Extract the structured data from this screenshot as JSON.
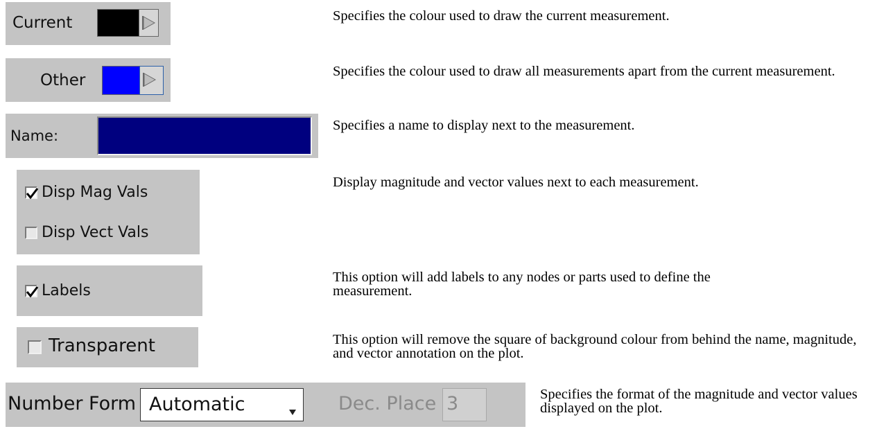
{
  "colours": {
    "current": "#000000",
    "other": "#0000ff",
    "name_field": "#00007f",
    "panel_bg": "#c4c4c4"
  },
  "rows": {
    "current": {
      "label": "Current",
      "swatch_color": "#000000",
      "arrow_icon": "triangle-right-icon",
      "description": "Specifies the colour used to draw the current measurement."
    },
    "other": {
      "label": "Other",
      "swatch_color": "#0000ff",
      "arrow_icon": "triangle-right-icon",
      "description": "Specifies the colour used to draw all measurements apart from the current measurement."
    },
    "name": {
      "label": "Name:",
      "value": "",
      "description": "Specifies a name to display next to the measurement."
    },
    "disp": {
      "mag_label": "Disp Mag Vals",
      "mag_checked": true,
      "vect_label": "Disp Vect Vals",
      "vect_checked": false,
      "description": "Display magnitude and vector values next to each measurement."
    },
    "labels": {
      "label": "Labels",
      "checked": true,
      "description": "This option will add labels to any nodes or parts used to define the measurement."
    },
    "transparent": {
      "label": "Transparent",
      "checked": false,
      "description": "This option will remove the square of background colour from behind the name, magnitude, and vector annotation on the plot."
    },
    "number_form": {
      "label": "Number Form",
      "selected": "Automatic",
      "dropdown_icon": "dropdown-arrow-icon",
      "dec_place_label": "Dec. Place",
      "dec_place_value": "3",
      "description": "Specifies the format of the magnitude and vector values displayed on the plot."
    }
  }
}
